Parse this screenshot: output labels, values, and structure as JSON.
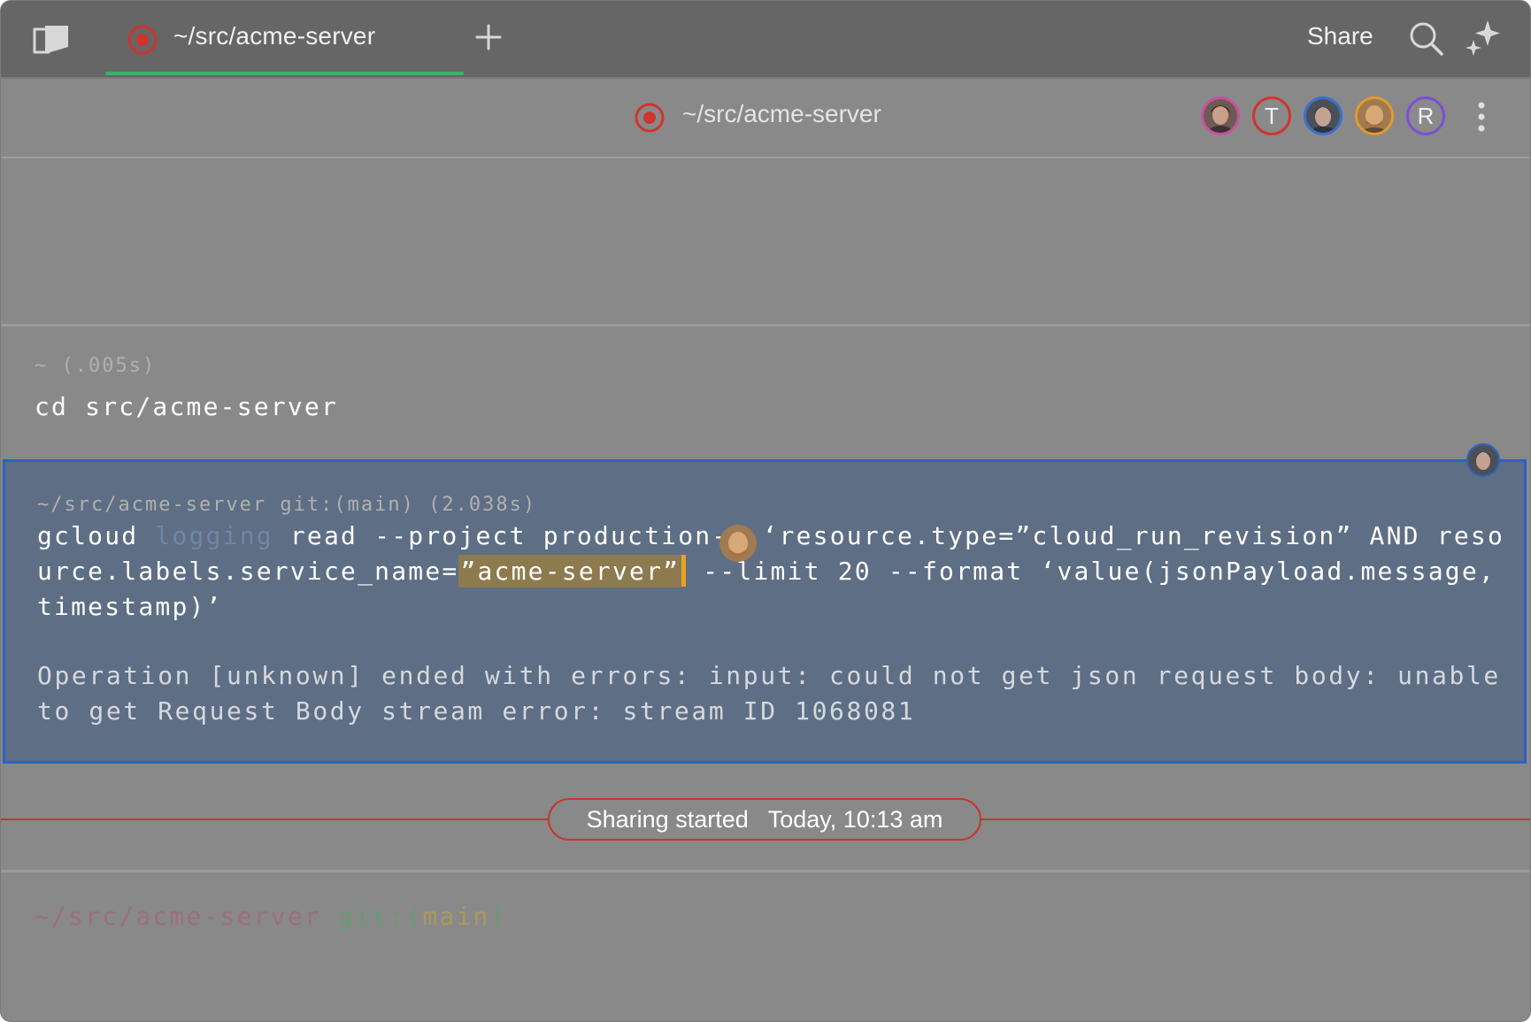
{
  "tabbar": {
    "tab_title": "~/src/acme-server",
    "share_label": "Share"
  },
  "session": {
    "title": "~/src/acme-server",
    "participants": [
      {
        "type": "photo",
        "ring": "#c94fa3"
      },
      {
        "type": "letter",
        "letter": "T",
        "ring": "#d0342c"
      },
      {
        "type": "photo",
        "ring": "#3b6fd0"
      },
      {
        "type": "photo",
        "ring": "#e39b2a"
      },
      {
        "type": "letter",
        "letter": "R",
        "ring": "#7a4fd6"
      }
    ]
  },
  "blocks": [
    {
      "meta": "~ (.005s)",
      "command": "cd src/acme-server"
    },
    {
      "meta": "~/src/acme-server git:(main) (2.038s)",
      "command_parts": {
        "p1": "gcloud ",
        "p2": "logging",
        "p3": " read --project production-",
        "p4": "v ‘resource.type=”cloud_run_revision” AND resource.labels.service_name=",
        "p5": "”acme-server”",
        "p6": " --limit 20 --format ‘value(jsonPayload.message, timestamp)’"
      },
      "output": "Operation [unknown] ended with errors: input: could not get json request body: unable to get Request Body stream error: stream ID 1068081"
    }
  ],
  "sharing_banner": {
    "label": "Sharing started",
    "time": "Today, 10:13 am"
  },
  "prompt": {
    "path": "~/src/acme-server",
    "git": "git:(",
    "branch": "main",
    "close": ")"
  },
  "colors": {
    "accent_recording": "#d0342c",
    "selection_border": "#2c62c6",
    "tab_underline": "#3cb06a"
  },
  "icons": [
    "sidebar-toggle-icon",
    "record-icon",
    "plus-icon",
    "search-icon",
    "ai-sparkle-icon",
    "more-vertical-icon"
  ]
}
